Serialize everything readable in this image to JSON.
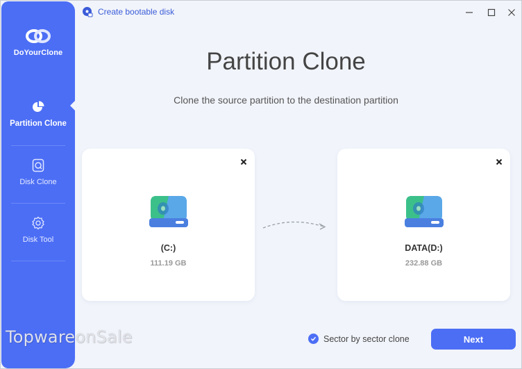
{
  "app": {
    "name": "DoYourClone",
    "create_bootable": "Create bootable disk"
  },
  "sidebar": {
    "items": [
      {
        "label": "Partition Clone",
        "icon": "pie-chart-icon",
        "active": true
      },
      {
        "label": "Disk Clone",
        "icon": "disk-icon",
        "active": false
      },
      {
        "label": "Disk Tool",
        "icon": "gear-icon",
        "active": false
      }
    ]
  },
  "main": {
    "title": "Partition Clone",
    "subtitle": "Clone the source partition to the destination partition",
    "source": {
      "name": "(C:)",
      "size": "111.19 GB"
    },
    "destination": {
      "name": "DATA(D:)",
      "size": "232.88 GB"
    },
    "sector_clone_label": "Sector by sector clone",
    "sector_clone_checked": true,
    "next_label": "Next"
  },
  "watermark": {
    "text_a": "Topware",
    "text_b": "onSale"
  },
  "colors": {
    "accent": "#4c6ef5",
    "background": "#f1f4fa",
    "sidebar": "#4c6ef5"
  }
}
